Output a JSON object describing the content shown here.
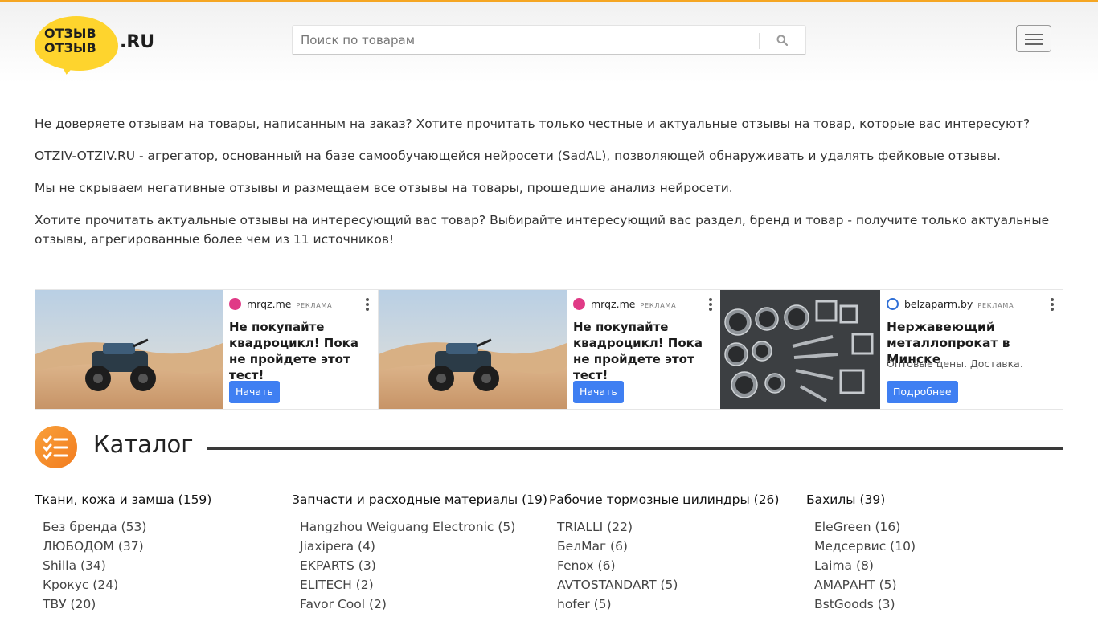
{
  "header": {
    "logo_word_1": "ОТЗЫВ",
    "logo_word_2": "ОТЗЫВ",
    "logo_suffix": ".RU",
    "search": {
      "placeholder": "Поиск по товарам",
      "value": ""
    },
    "search_icon": "search-icon",
    "menu_icon": "hamburger-icon"
  },
  "colors": {
    "accent_bar": "#f5a623",
    "logo_yellow": "#fed42d",
    "catalog_icon": "#f7901e",
    "ad_button": "#3f7ff2"
  },
  "intro": {
    "p1": "Не доверяете отзывам на товары, написанным на заказ? Хотите прочитать только честные и актуальные отзывы на товар, которые вас интересуют?",
    "p2": "OTZIV-OTZIV.RU - агрегатор, основанный на базе самообучающейся нейросети (SadAL), позволяющей обнаруживать и удалять фейковые отзывы.",
    "p3": "Мы не скрываем негативные отзывы и размещаем все отзывы на товары, прошедшие анализ нейросети.",
    "p4": "Хотите прочитать актуальные отзывы на интересующий вас товар? Выбирайте интересующий вас раздел, бренд и товар - получите только актуальные отзывы, агрегированные более чем из 11 источников!"
  },
  "ads": [
    {
      "source": "mrqz.me",
      "tag": "РЕКЛАМА",
      "title_line1": "Не покупайте",
      "title_line2": "квадроцикл! Пока",
      "title_line3": "не пройдете этот тест!",
      "subtitle": "",
      "cta": "Начать",
      "image": "atv-in-desert"
    },
    {
      "source": "mrqz.me",
      "tag": "РЕКЛАМА",
      "title_line1": "Не покупайте",
      "title_line2": "квадроцикл! Пока",
      "title_line3": "не пройдете этот тест!",
      "subtitle": "",
      "cta": "Начать",
      "image": "atv-in-desert"
    },
    {
      "source": "belzaparm.by",
      "tag": "РЕКЛАМА",
      "title_line1": "Нержавеющий",
      "title_line2": "металлопрокат в Минске",
      "title_line3": "",
      "subtitle": "Оптовые цены. Доставка.",
      "cta": "Подробнее",
      "image": "steel-pipes"
    }
  ],
  "catalog": {
    "title": "Каталог",
    "icon": "checklist-icon",
    "columns": [
      {
        "heading": "Ткани, кожа и замша (159)",
        "items": [
          "Без бренда (53)",
          "ЛЮБОДОМ (37)",
          "Shilla (34)",
          "Крокус (24)",
          "ТВУ (20)"
        ]
      },
      {
        "heading": "Запчасти и расходные материалы (19)",
        "items": [
          "Hangzhou Weiguang Electronic (5)",
          "Jiaxipera (4)",
          "EKPARTS (3)",
          "ELITECH (2)",
          "Favor Cool (2)"
        ]
      },
      {
        "heading": "Рабочие тормозные цилиндры (26)",
        "items": [
          "TRIALLI (22)",
          "БелМаг (6)",
          "Fenox (6)",
          "AVTOSTANDART (5)",
          "hofer (5)"
        ]
      },
      {
        "heading": "Бахилы (39)",
        "items": [
          "EleGreen (16)",
          "Медсервис (10)",
          "Laima (8)",
          "АМАРАНТ (5)",
          "BstGoods (3)"
        ]
      }
    ]
  }
}
